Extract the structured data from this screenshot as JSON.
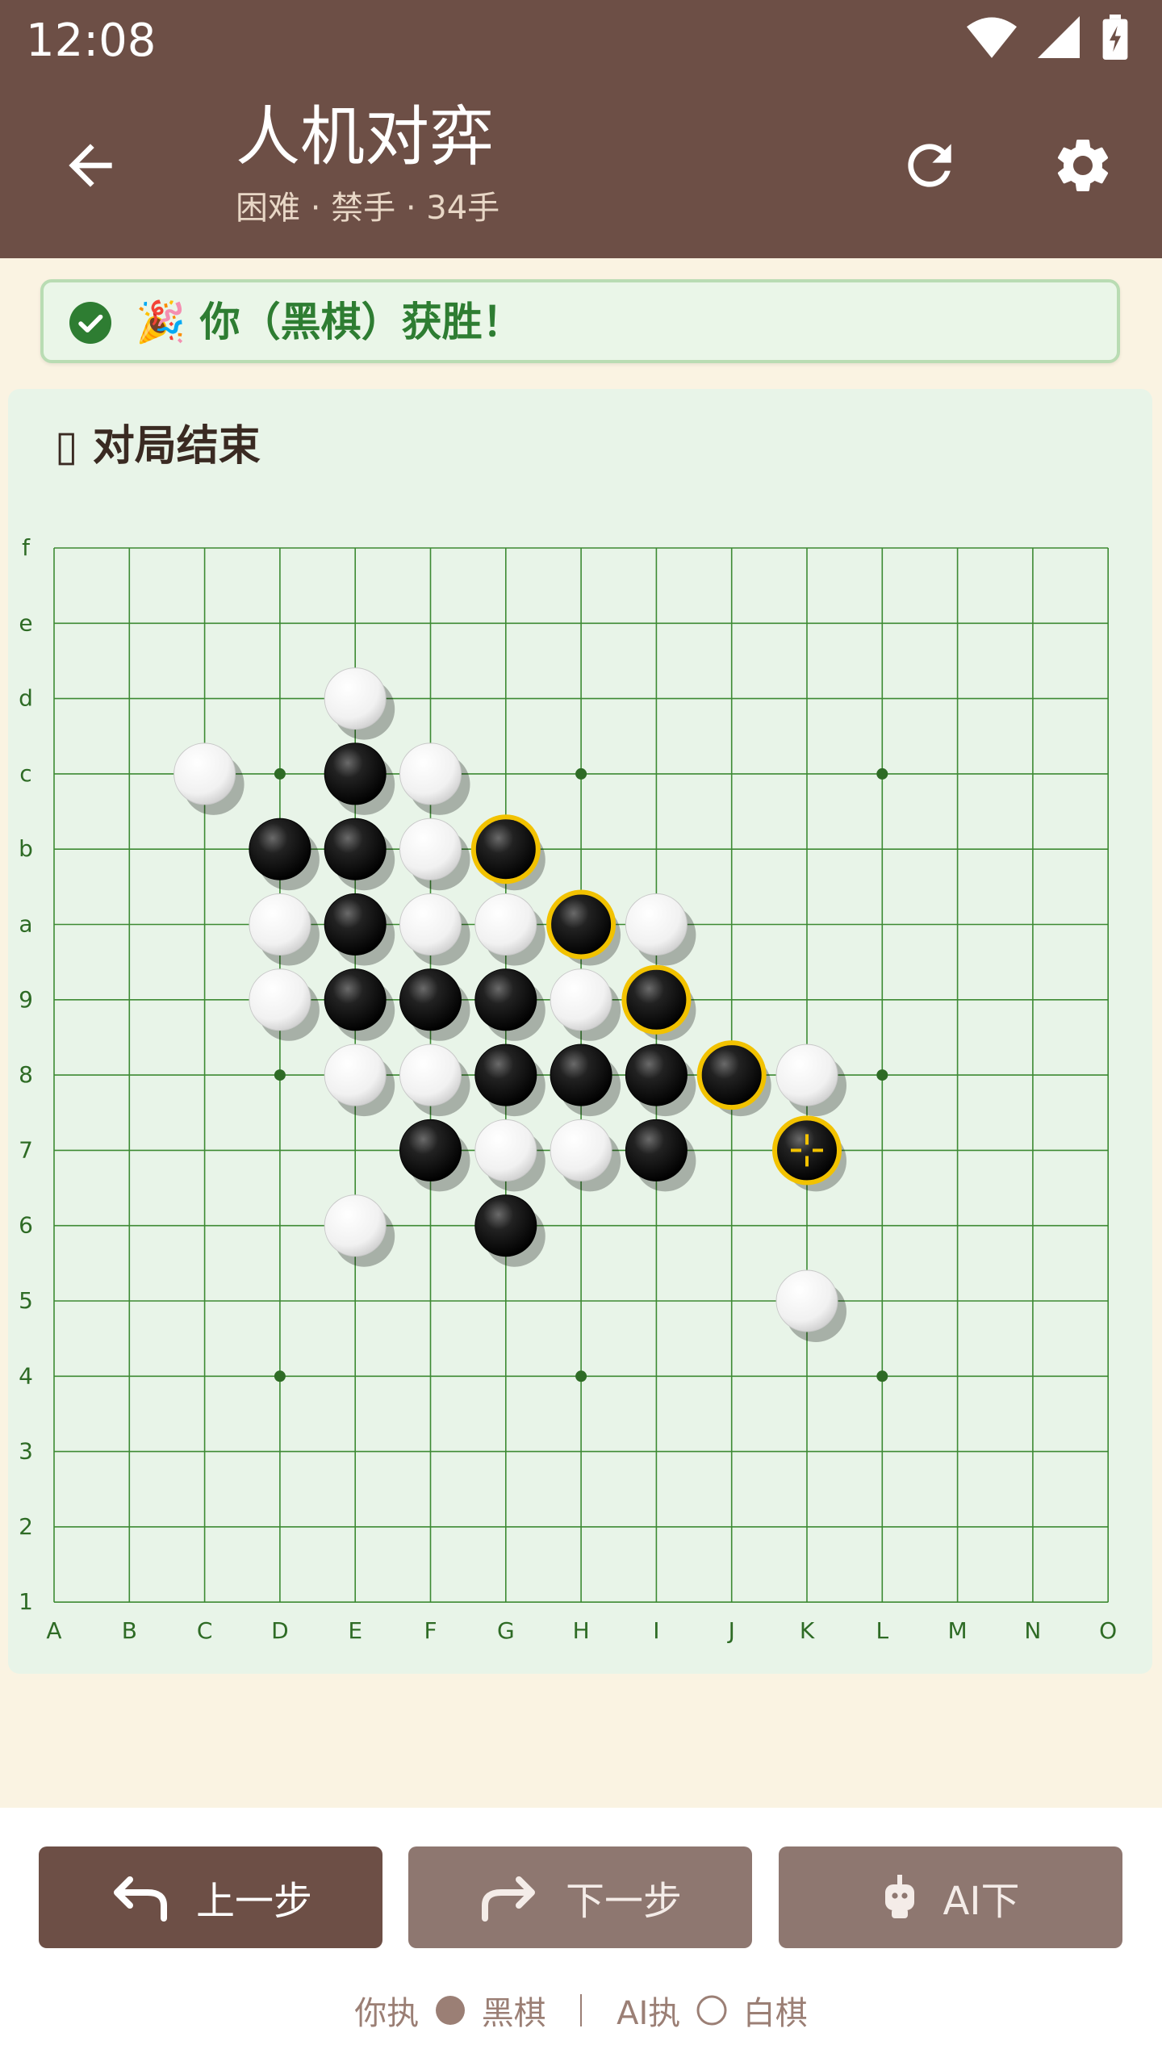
{
  "status_bar": {
    "time": "12:08"
  },
  "app_bar": {
    "title": "人机对弈",
    "subtitle": "困难 · 禁手 · 34手",
    "back_icon": "arrow-left-icon",
    "refresh_icon": "refresh-icon",
    "settings_icon": "gear-icon"
  },
  "banner": {
    "text": "🎉 你（黑棋）获胜！",
    "icon": "check-circle-icon",
    "color": "#2e7d32"
  },
  "board": {
    "status": "▯ 对局结束",
    "columns": [
      "A",
      "B",
      "C",
      "D",
      "E",
      "F",
      "G",
      "H",
      "I",
      "J",
      "K",
      "L",
      "M",
      "N",
      "O"
    ],
    "rows": [
      "f",
      "e",
      "d",
      "c",
      "b",
      "a",
      "9",
      "8",
      "7",
      "6",
      "5",
      "4",
      "3",
      "2",
      "1"
    ],
    "star_points": [
      [
        3,
        3
      ],
      [
        3,
        7
      ],
      [
        3,
        11
      ],
      [
        7,
        3
      ],
      [
        7,
        11
      ],
      [
        11,
        3
      ],
      [
        11,
        7
      ],
      [
        11,
        11
      ]
    ],
    "black_stones": [
      [
        3,
        4
      ],
      [
        4,
        3
      ],
      [
        4,
        4
      ],
      [
        4,
        6
      ],
      [
        5,
        4
      ],
      [
        5,
        7
      ],
      [
        6,
        4
      ],
      [
        6,
        5
      ],
      [
        6,
        6
      ],
      [
        6,
        8
      ],
      [
        7,
        6
      ],
      [
        7,
        7
      ],
      [
        7,
        8
      ],
      [
        7,
        9
      ],
      [
        8,
        5
      ],
      [
        8,
        8
      ],
      [
        8,
        10
      ],
      [
        9,
        6
      ]
    ],
    "white_stones": [
      [
        2,
        4
      ],
      [
        3,
        2
      ],
      [
        3,
        5
      ],
      [
        4,
        5
      ],
      [
        5,
        3
      ],
      [
        5,
        5
      ],
      [
        5,
        6
      ],
      [
        5,
        8
      ],
      [
        6,
        3
      ],
      [
        6,
        7
      ],
      [
        7,
        4
      ],
      [
        7,
        5
      ],
      [
        7,
        10
      ],
      [
        8,
        6
      ],
      [
        8,
        7
      ],
      [
        9,
        4
      ],
      [
        10,
        10
      ]
    ],
    "winning_line": [
      [
        4,
        6
      ],
      [
        5,
        7
      ],
      [
        6,
        8
      ],
      [
        7,
        9
      ],
      [
        8,
        10
      ]
    ],
    "last_move": [
      8,
      10
    ]
  },
  "controls": {
    "prev_label": "上一步",
    "next_label": "下一步",
    "ai_label": "AI下",
    "prev_icon": "undo-arrow-icon",
    "next_icon": "redo-arrow-icon",
    "ai_icon": "robot-icon"
  },
  "players": {
    "you_label": "你执",
    "you_color": "黑棋",
    "ai_label": "AI执",
    "ai_color": "白棋"
  }
}
